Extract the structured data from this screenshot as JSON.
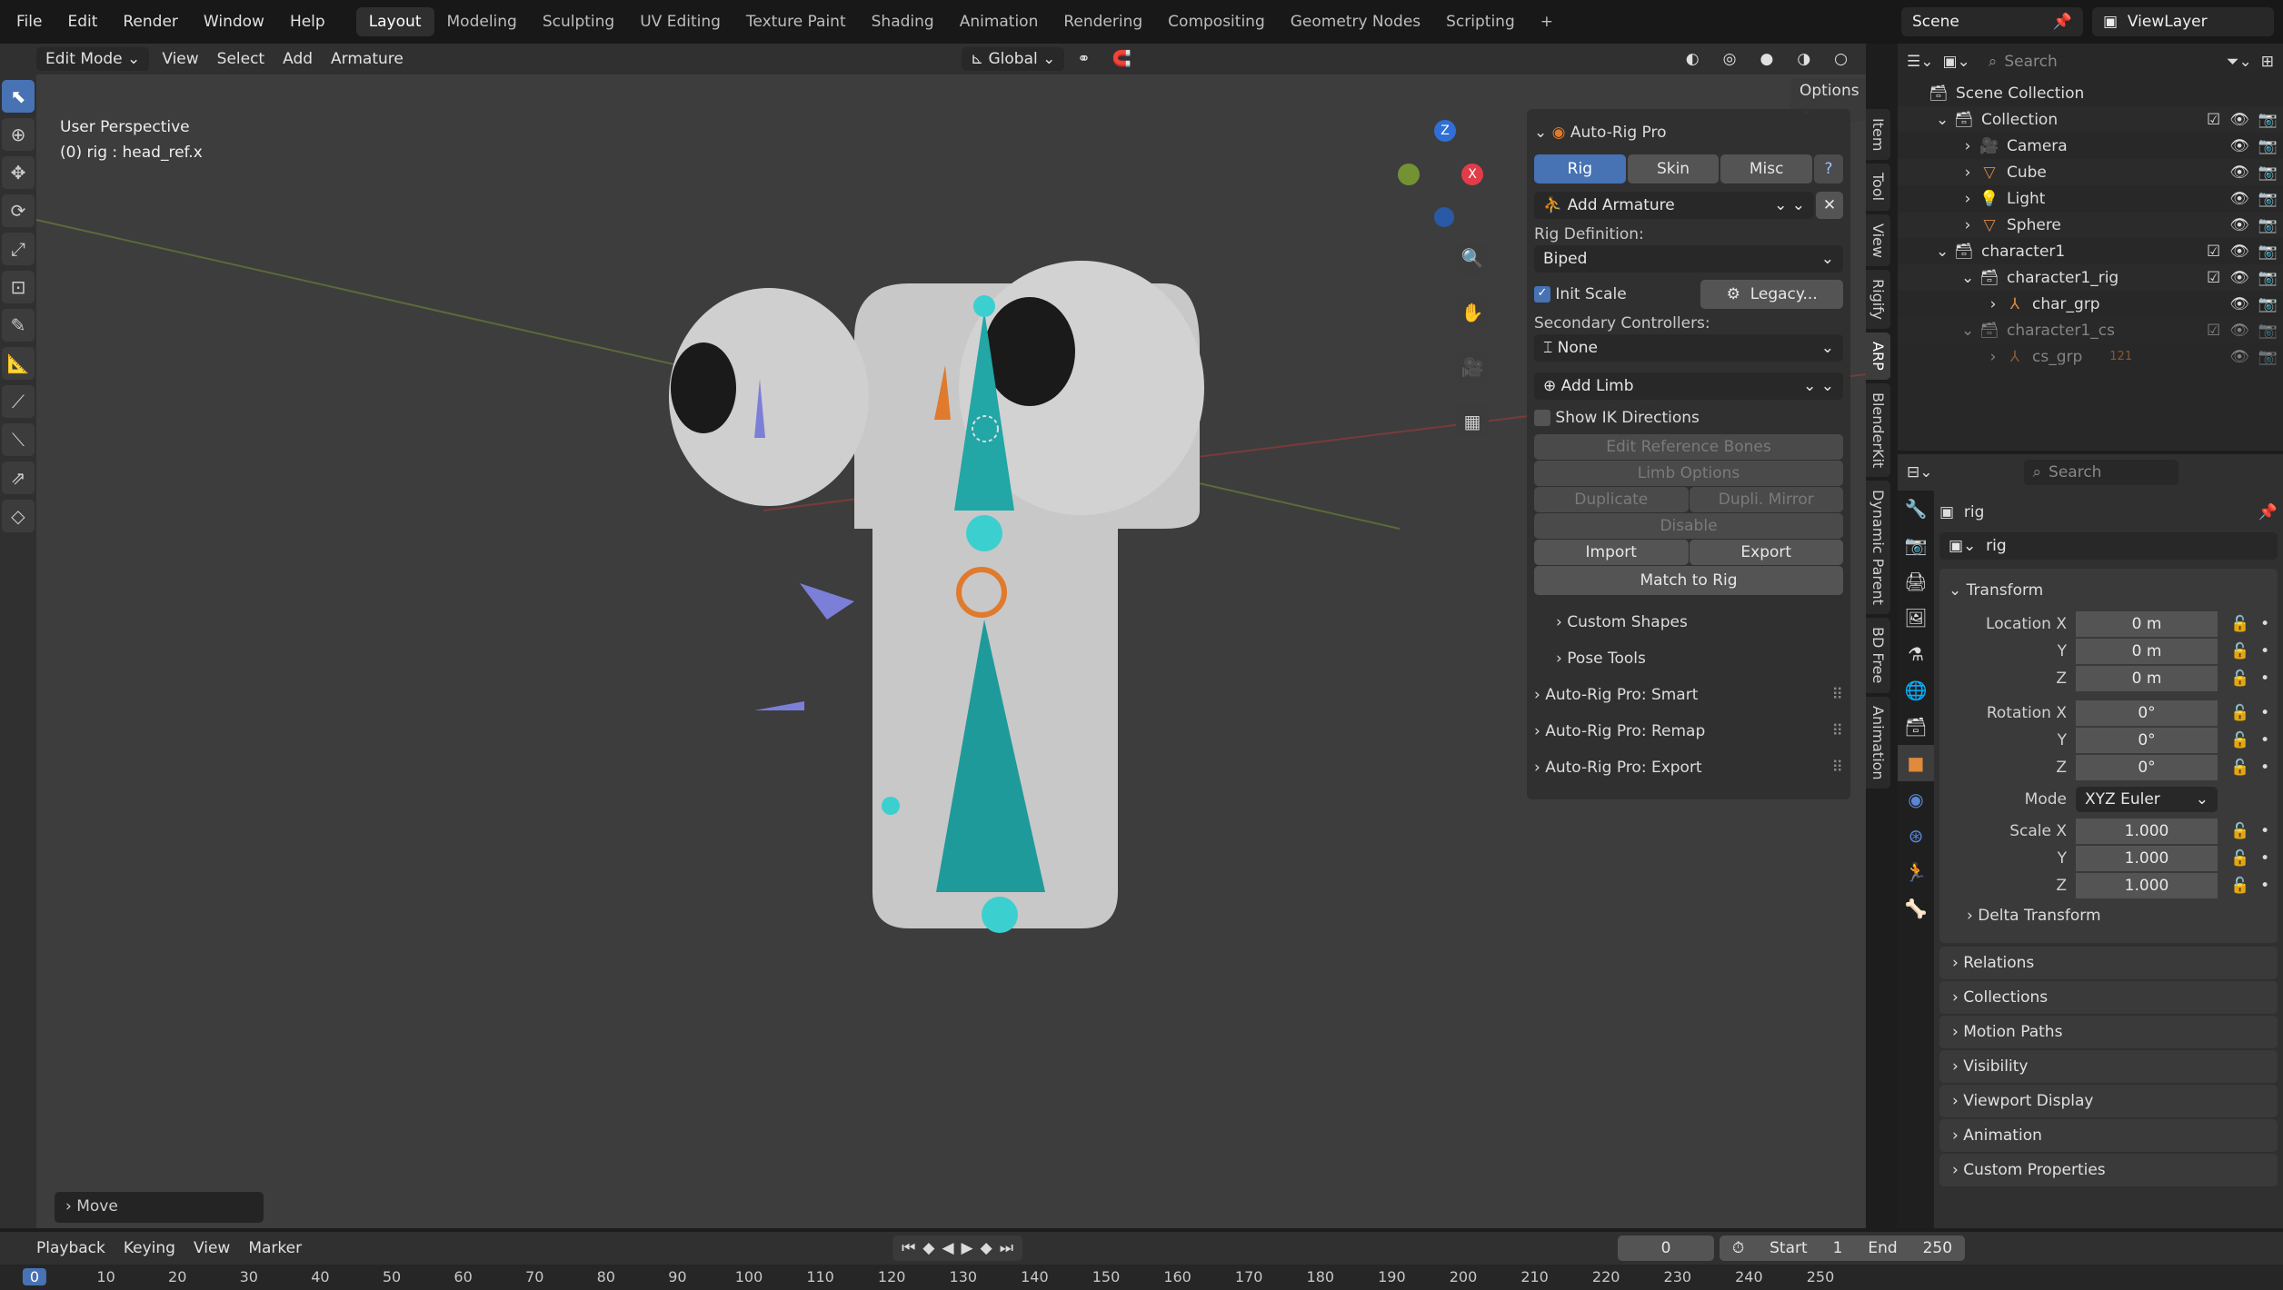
{
  "menubar": {
    "items": [
      "File",
      "Edit",
      "Render",
      "Window",
      "Help"
    ],
    "workspaces": [
      "Layout",
      "Modeling",
      "Sculpting",
      "UV Editing",
      "Texture Paint",
      "Shading",
      "Animation",
      "Rendering",
      "Compositing",
      "Geometry Nodes",
      "Scripting"
    ],
    "active_workspace": "Layout",
    "add": "+",
    "scene": "Scene",
    "view_layer": "ViewLayer"
  },
  "header": {
    "mode": "Edit Mode",
    "menus": [
      "View",
      "Select",
      "Add",
      "Armature"
    ],
    "orientation": "Global",
    "options": "Options"
  },
  "viewport": {
    "perspective": "User Perspective",
    "object_info": "(0) rig : head_ref.x",
    "last_op": "Move",
    "gizmo": {
      "x": "X",
      "y": "Y",
      "z": "Z"
    }
  },
  "npanel": {
    "title": "Auto-Rig Pro",
    "tabs": [
      "Rig",
      "Skin",
      "Misc"
    ],
    "active_tab": "Rig",
    "help": "?",
    "add_armature": "Add Armature",
    "rig_def_label": "Rig Definition:",
    "rig_def": "Biped",
    "init_scale": "Init Scale",
    "init_scale_checked": true,
    "legacy": "Legacy...",
    "secondary_label": "Secondary Controllers:",
    "secondary": "None",
    "add_limb": "Add Limb",
    "show_ik": "Show IK Directions",
    "edit_ref": "Edit Reference Bones",
    "limb_options": "Limb Options",
    "duplicate": "Duplicate",
    "dupli_mirror": "Dupli. Mirror",
    "disable": "Disable",
    "import": "Import",
    "export": "Export",
    "match": "Match to Rig",
    "subpanels": [
      "Custom Shapes",
      "Pose Tools"
    ],
    "panels": [
      "Auto-Rig Pro: Smart",
      "Auto-Rig Pro: Remap",
      "Auto-Rig Pro: Export"
    ]
  },
  "side_tabs": [
    "Item",
    "Tool",
    "View",
    "Rigify",
    "ARP",
    "BlenderKit",
    "Dynamic Parent",
    "BD Free",
    "Animation"
  ],
  "active_side_tab": "ARP",
  "outliner": {
    "search_placeholder": "Search",
    "items": [
      {
        "name": "Scene Collection",
        "depth": 0,
        "icon": "collection-icon"
      },
      {
        "name": "Collection",
        "depth": 1,
        "icon": "collection-icon",
        "expanded": true,
        "checkbox": true
      },
      {
        "name": "Camera",
        "depth": 2,
        "icon": "camera-icon"
      },
      {
        "name": "Cube",
        "depth": 2,
        "icon": "mesh-icon"
      },
      {
        "name": "Light",
        "depth": 2,
        "icon": "light-icon"
      },
      {
        "name": "Sphere",
        "depth": 2,
        "icon": "mesh-icon"
      },
      {
        "name": "character1",
        "depth": 1,
        "icon": "collection-icon",
        "expanded": true,
        "checkbox": true
      },
      {
        "name": "character1_rig",
        "depth": 2,
        "icon": "collection-icon",
        "expanded": true,
        "checkbox": true
      },
      {
        "name": "char_grp",
        "depth": 3,
        "icon": "empty-icon"
      },
      {
        "name": "character1_cs",
        "depth": 2,
        "icon": "collection-icon",
        "expanded": true,
        "checkbox": true,
        "dim": true
      },
      {
        "name": "cs_grp",
        "depth": 3,
        "icon": "empty-icon",
        "dim": true,
        "badge": "121"
      }
    ]
  },
  "properties": {
    "search_placeholder": "Search",
    "object": "rig",
    "data_name": "rig",
    "transform": "Transform",
    "rows": [
      {
        "label": "Location X",
        "value": "0 m"
      },
      {
        "label": "Y",
        "value": "0 m"
      },
      {
        "label": "Z",
        "value": "0 m"
      },
      {
        "label": "Rotation X",
        "value": "0°"
      },
      {
        "label": "Y",
        "value": "0°"
      },
      {
        "label": "Z",
        "value": "0°"
      }
    ],
    "mode_label": "Mode",
    "mode": "XYZ Euler",
    "scale": [
      {
        "label": "Scale X",
        "value": "1.000"
      },
      {
        "label": "Y",
        "value": "1.000"
      },
      {
        "label": "Z",
        "value": "1.000"
      }
    ],
    "delta": "Delta Transform",
    "sections": [
      "Relations",
      "Collections",
      "Motion Paths",
      "Visibility",
      "Viewport Display",
      "Animation",
      "Custom Properties"
    ]
  },
  "timeline": {
    "menus": [
      "Playback",
      "Keying",
      "View",
      "Marker"
    ],
    "current_frame": "0",
    "start_label": "Start",
    "start": "1",
    "end_label": "End",
    "end": "250",
    "ticks": [
      "0",
      "10",
      "20",
      "30",
      "40",
      "50",
      "60",
      "70",
      "80",
      "90",
      "100",
      "110",
      "120",
      "130",
      "140",
      "150",
      "160",
      "170",
      "180",
      "190",
      "200",
      "210",
      "220",
      "230",
      "240",
      "250"
    ]
  },
  "colors": {
    "accent": "#4772b3",
    "bone": "#22a6a6",
    "orange": "#e07a2c",
    "bg": "#3d3d3d"
  }
}
